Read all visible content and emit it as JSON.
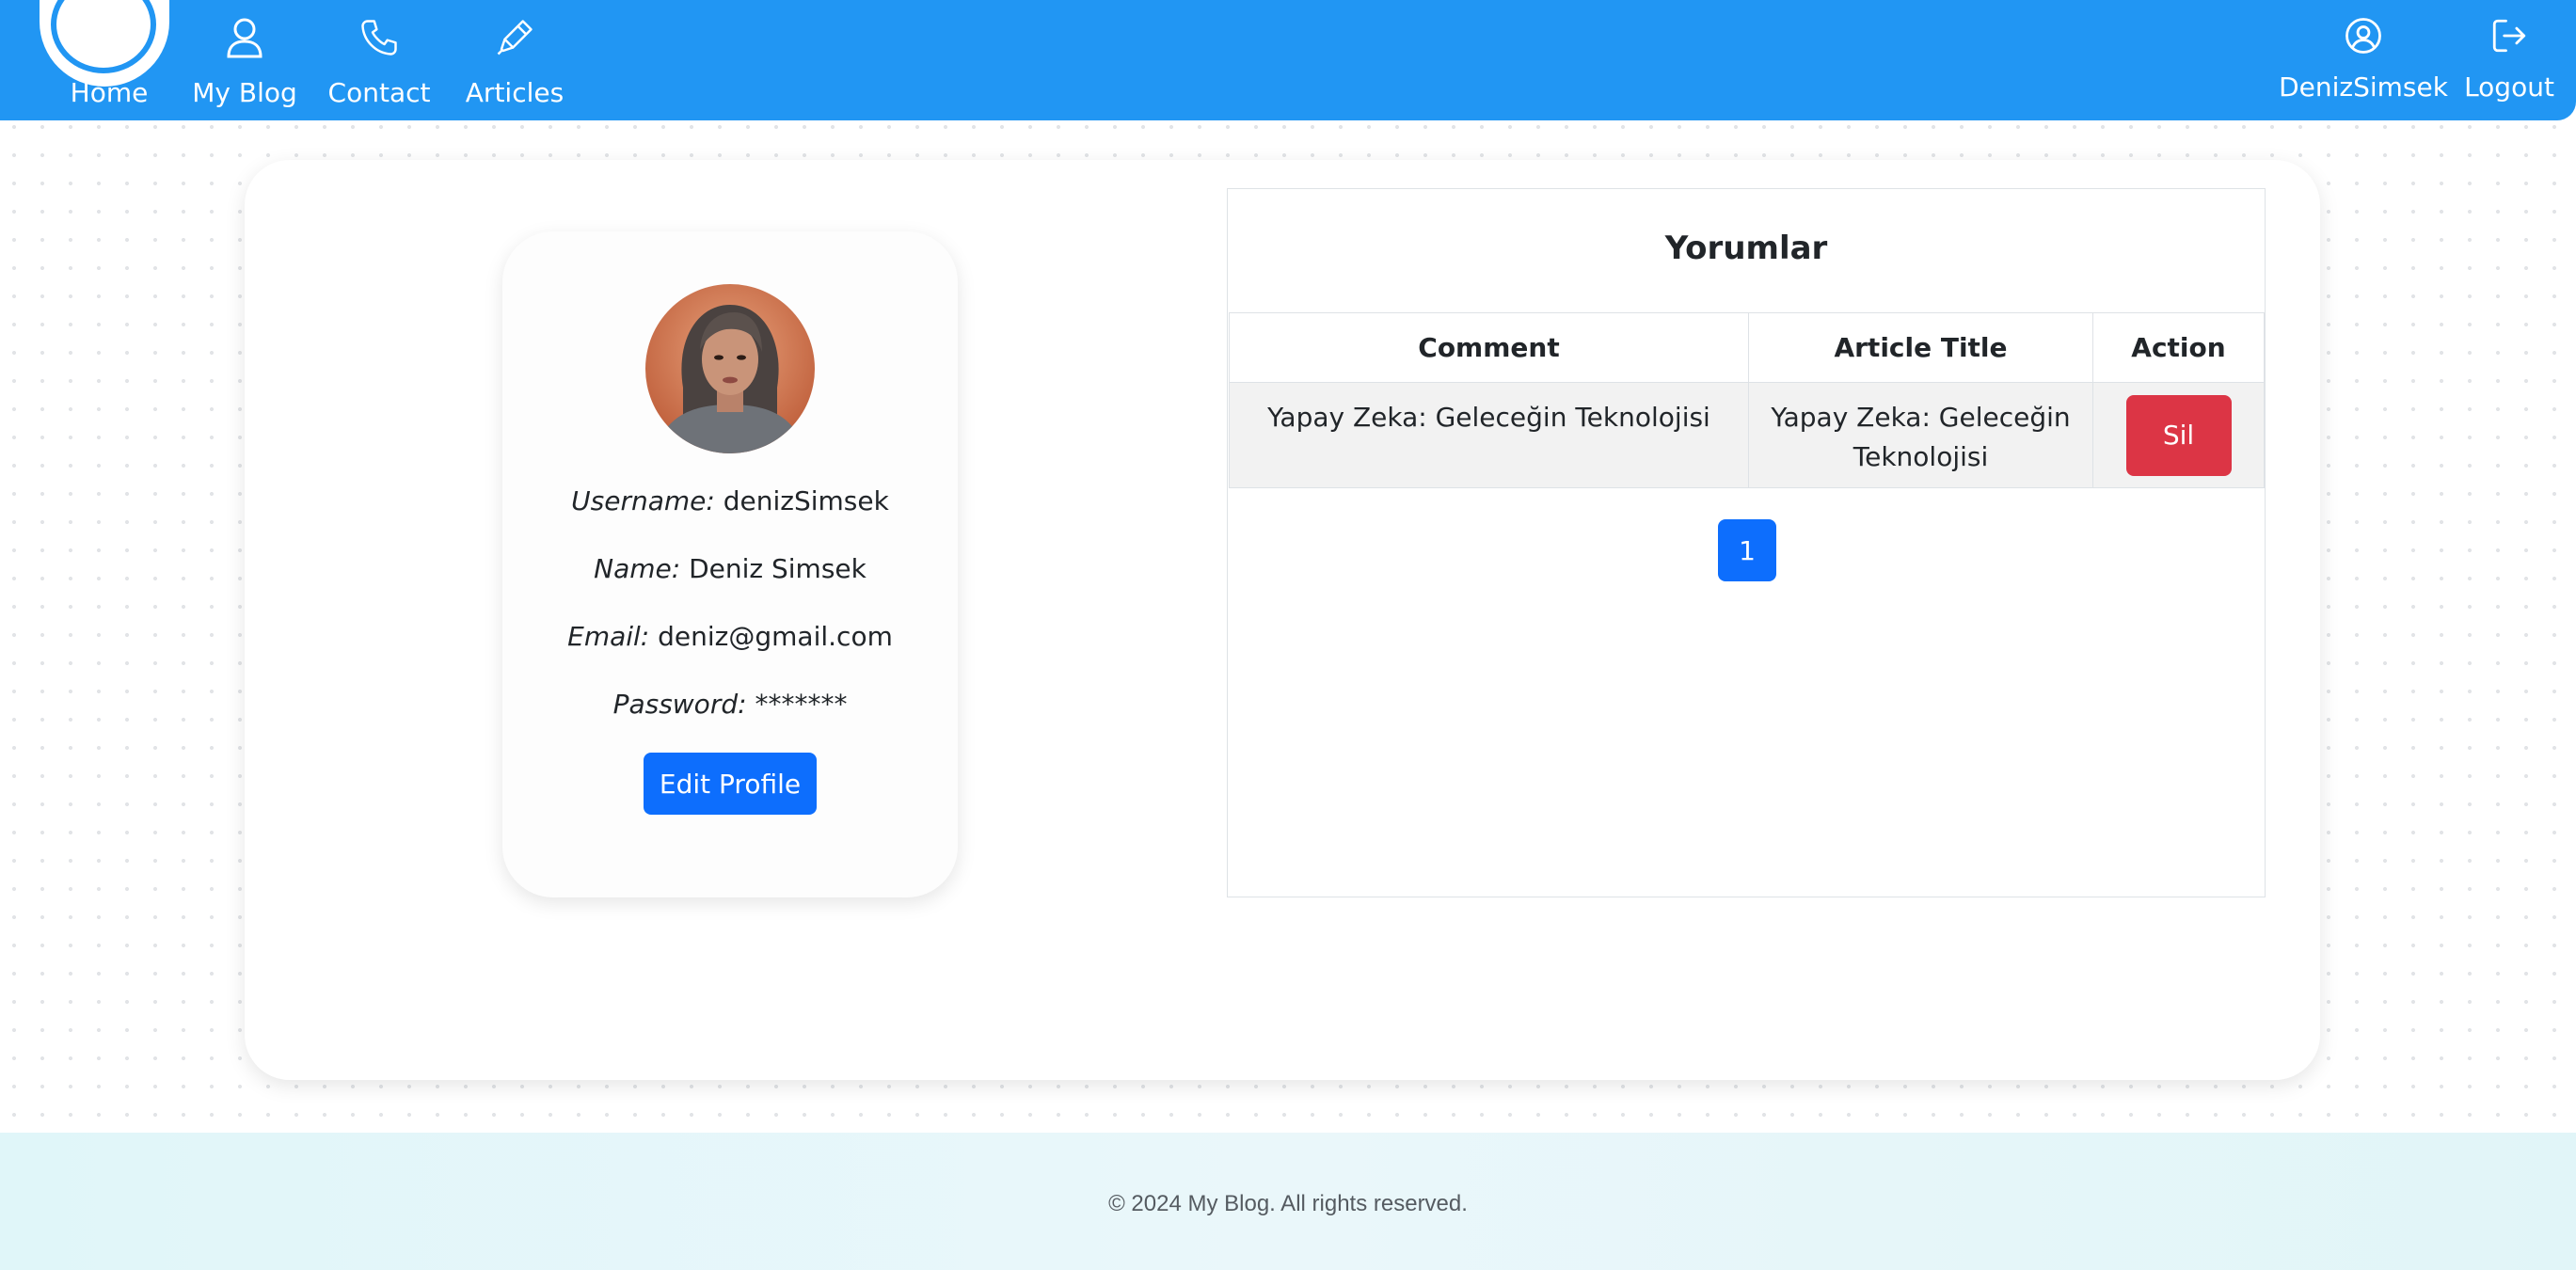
{
  "nav": {
    "items": [
      {
        "label": "Home",
        "icon": "home-logo"
      },
      {
        "label": "My Blog",
        "icon": "user-icon"
      },
      {
        "label": "Contact",
        "icon": "phone-icon"
      },
      {
        "label": "Articles",
        "icon": "pen-icon"
      }
    ],
    "user_label": "DenizSimsek",
    "logout_label": "Logout"
  },
  "profile": {
    "username_label": "Username:",
    "username": "denizSimsek",
    "name_label": "Name:",
    "name": "Deniz Simsek",
    "email_label": "Email:",
    "email": "deniz@gmail.com",
    "password_label": "Password:",
    "password": "*******",
    "edit_button": "Edit Profile"
  },
  "comments": {
    "title": "Yorumlar",
    "columns": [
      "Comment",
      "Article Title",
      "Action"
    ],
    "rows": [
      {
        "comment": "Yapay Zeka: Geleceğin Teknolojisi",
        "article_title": "Yapay Zeka: Geleceğin Teknolojisi",
        "action": "Sil"
      }
    ],
    "pagination": {
      "current": "1"
    }
  },
  "footer": {
    "text": "© 2024 My Blog. All rights reserved."
  },
  "colors": {
    "navbar": "#2196f3",
    "primary": "#0d6efd",
    "danger": "#dc3545",
    "footer_bg": "#e6f7fa"
  }
}
